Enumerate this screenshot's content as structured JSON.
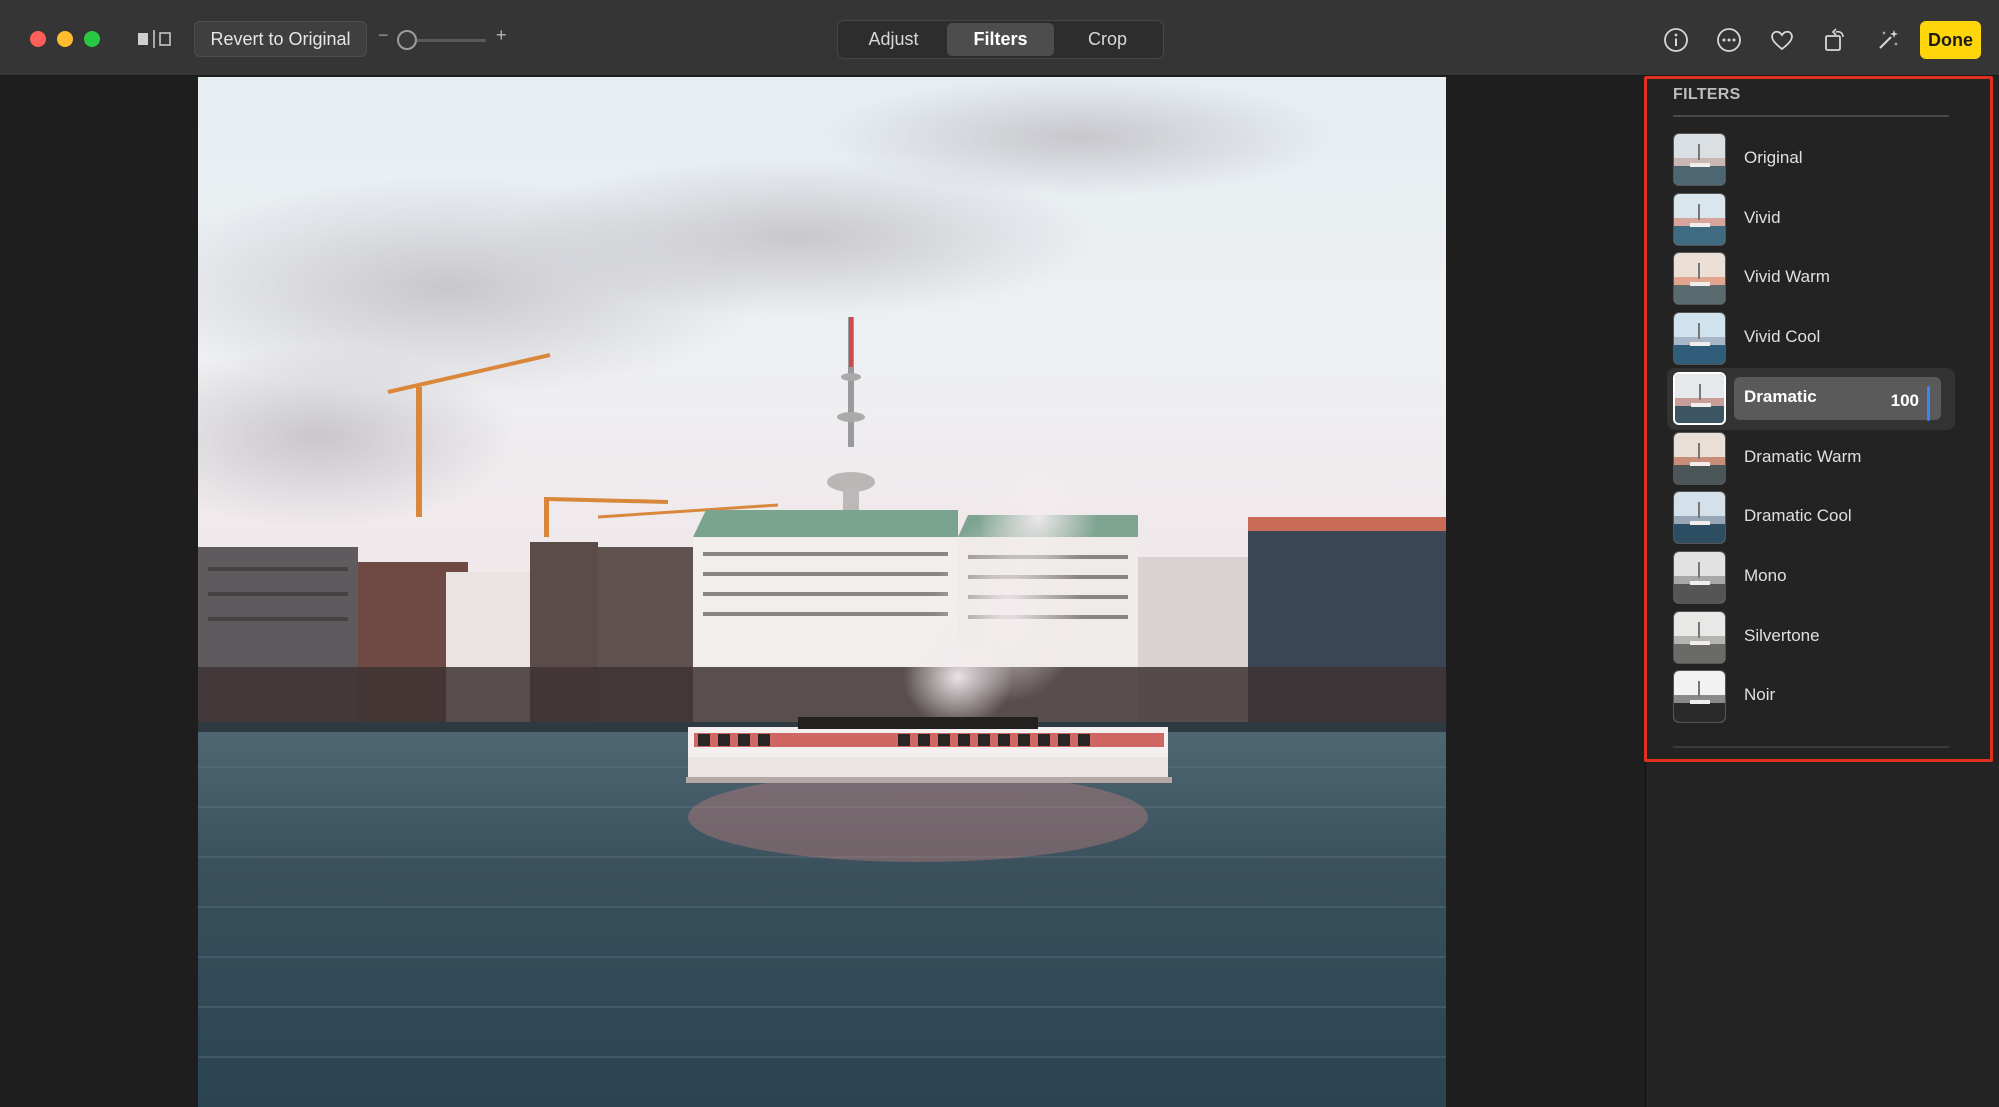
{
  "window": {
    "traffic_lights": [
      "close",
      "minimize",
      "zoom"
    ]
  },
  "toolbar": {
    "revert_label": "Revert to Original",
    "zoom_minus": "−",
    "zoom_plus": "+",
    "tabs": [
      {
        "label": "Adjust",
        "active": false
      },
      {
        "label": "Filters",
        "active": true
      },
      {
        "label": "Crop",
        "active": false
      }
    ],
    "icons": [
      "info-icon",
      "more-icon",
      "heart-icon",
      "rotate-icon",
      "magic-wand-icon"
    ],
    "done_label": "Done",
    "accent_color": "#ffd60a"
  },
  "sidebar": {
    "title": "FILTERS",
    "filters": [
      {
        "label": "Original",
        "selected": false,
        "tone": "original"
      },
      {
        "label": "Vivid",
        "selected": false,
        "tone": "vivid"
      },
      {
        "label": "Vivid Warm",
        "selected": false,
        "tone": "warm"
      },
      {
        "label": "Vivid Cool",
        "selected": false,
        "tone": "cool"
      },
      {
        "label": "Dramatic",
        "selected": true,
        "value": "100",
        "tone": "dramatic"
      },
      {
        "label": "Dramatic Warm",
        "selected": false,
        "tone": "dramwarm"
      },
      {
        "label": "Dramatic Cool",
        "selected": false,
        "tone": "dramcool"
      },
      {
        "label": "Mono",
        "selected": false,
        "tone": "mono"
      },
      {
        "label": "Silvertone",
        "selected": false,
        "tone": "silver"
      },
      {
        "label": "Noir",
        "selected": false,
        "tone": "noir"
      }
    ],
    "highlight_color": "#e0301e"
  }
}
